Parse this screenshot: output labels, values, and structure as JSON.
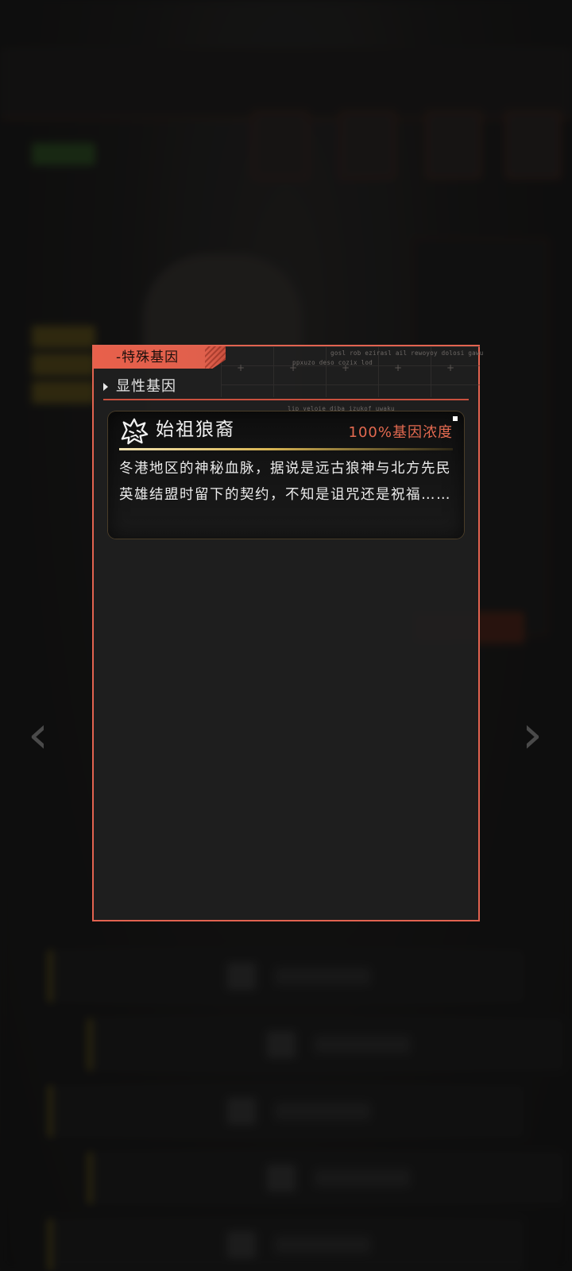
{
  "panel": {
    "tab_label": "-特殊基因",
    "code_line_1": "gosl rob ezirasl ail rewoyoy dolosi gawu",
    "code_line_2": "ppxuzo deso cozix lod",
    "code_line_3": "lip yeloie diba izukof uwaku",
    "section_label": "显性基因"
  },
  "gene": {
    "icon": "wolf-head-icon",
    "name": "始祖狼裔",
    "concentration": "100%基因浓度",
    "description": "冬港地区的神秘血脉，据说是远古狼神与北方先民英雄结盟时留下的契约，不知是诅咒还是祝福……"
  },
  "navigation": {
    "prev_arrow": "‹",
    "next_arrow": "›"
  },
  "colors": {
    "accent": "#e26350",
    "concentration": "#e46a50",
    "divider_gold": "#d8b554"
  }
}
